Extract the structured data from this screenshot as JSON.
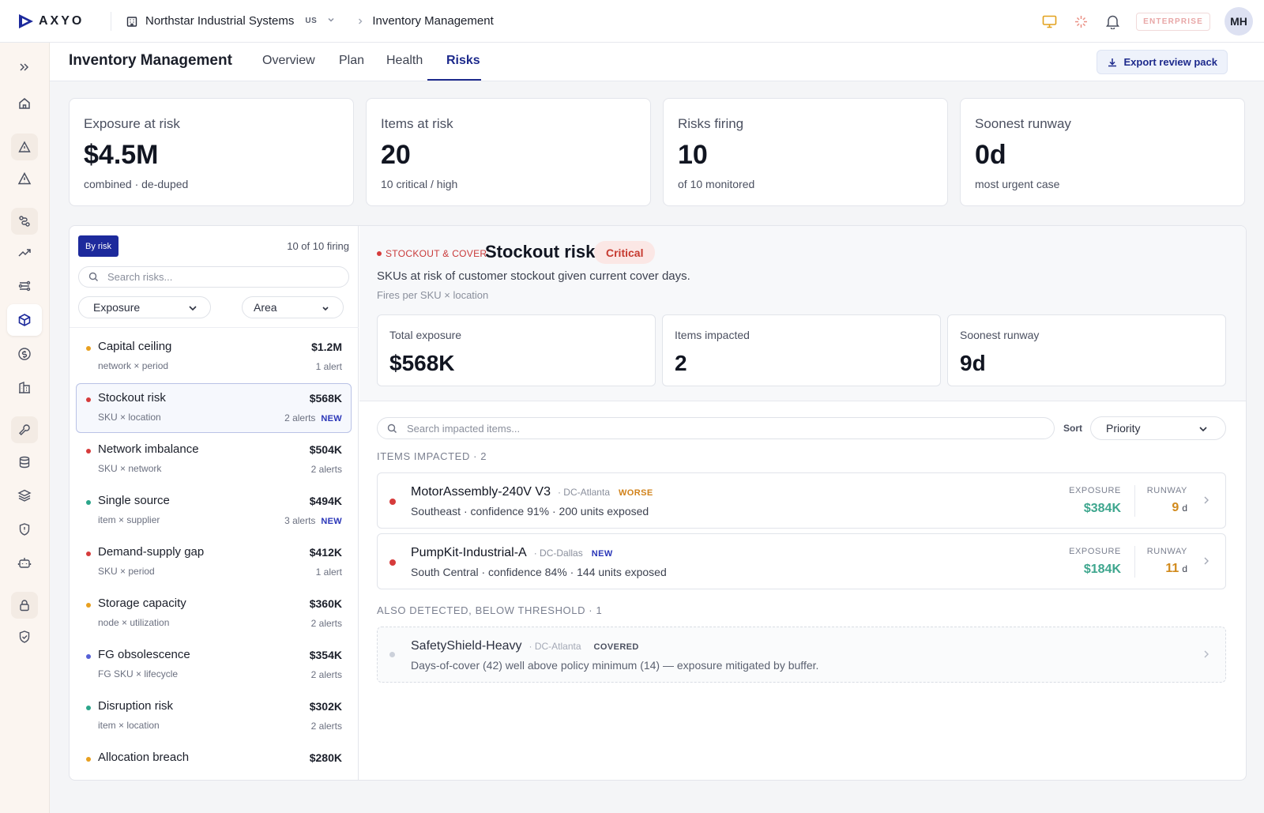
{
  "topbar": {
    "brand": "AXYO",
    "org_name": "Northstar Industrial Systems",
    "org_region": "US",
    "breadcrumb": "Inventory Management",
    "plan_badge": "ENTERPRISE",
    "avatar_initials": "MH"
  },
  "rail_icons": [
    "expand-icon",
    "home-icon",
    "alert-icon",
    "warning-icon",
    "route-icon",
    "trend-icon",
    "flow-icon",
    "inventory-icon",
    "finance-icon",
    "building-icon",
    "tools-icon",
    "database-icon",
    "layers-icon",
    "shield-icon",
    "robot-icon",
    "lock-icon",
    "shield-check-icon"
  ],
  "subheader": {
    "title": "Inventory Management",
    "tabs": [
      {
        "label": "Overview"
      },
      {
        "label": "Plan"
      },
      {
        "label": "Health"
      },
      {
        "label": "Risks"
      }
    ],
    "active_tab": "Risks",
    "export_label": "Export review pack"
  },
  "kpis": [
    {
      "label": "Exposure at risk",
      "value": "$4.5M",
      "sub": "combined · de-duped"
    },
    {
      "label": "Items at risk",
      "value": "20",
      "sub": "10 critical / high"
    },
    {
      "label": "Risks firing",
      "value": "10",
      "sub": "of 10 monitored"
    },
    {
      "label": "Soonest runway",
      "value": "0d",
      "sub": "most urgent case"
    }
  ],
  "risk_list": {
    "sort_chip": "By risk",
    "count_label": "10 of 10 firing",
    "search_placeholder": "Search risks...",
    "sort_select": "Exposure",
    "area_select": "Area",
    "items": [
      {
        "name": "Capital ceiling",
        "sub": "network × period",
        "amount": "$1.2M",
        "alerts": "1 alert",
        "new": "",
        "color": "#e8a020"
      },
      {
        "name": "Stockout risk",
        "sub": "SKU × location",
        "amount": "$568K",
        "alerts": "2 alerts",
        "new": "NEW",
        "color": "#d63b3b"
      },
      {
        "name": "Network imbalance",
        "sub": "SKU × network",
        "amount": "$504K",
        "alerts": "2 alerts",
        "new": "",
        "color": "#d63b3b"
      },
      {
        "name": "Single source",
        "sub": "item × supplier",
        "amount": "$494K",
        "alerts": "3 alerts",
        "new": "NEW",
        "color": "#2ba58a"
      },
      {
        "name": "Demand-supply gap",
        "sub": "SKU × period",
        "amount": "$412K",
        "alerts": "1 alert",
        "new": "",
        "color": "#d63b3b"
      },
      {
        "name": "Storage capacity",
        "sub": "node × utilization",
        "amount": "$360K",
        "alerts": "2 alerts",
        "new": "",
        "color": "#e8a020"
      },
      {
        "name": "FG obsolescence",
        "sub": "FG SKU × lifecycle",
        "amount": "$354K",
        "alerts": "2 alerts",
        "new": "",
        "color": "#5560d6"
      },
      {
        "name": "Disruption risk",
        "sub": "item × location",
        "amount": "$302K",
        "alerts": "2 alerts",
        "new": "",
        "color": "#2ba58a"
      },
      {
        "name": "Allocation breach",
        "sub": "",
        "amount": "$280K",
        "alerts": "",
        "new": "",
        "color": "#e8a020"
      }
    ]
  },
  "detail": {
    "category": "STOCKOUT & COVER",
    "title": "Stockout risk",
    "severity": "Critical",
    "description": "SKUs at risk of customer stockout given current cover days.",
    "fires_per": "Fires per SKU × location",
    "metrics": [
      {
        "label": "Total exposure",
        "value": "$568K"
      },
      {
        "label": "Items impacted",
        "value": "2"
      },
      {
        "label": "Soonest runway",
        "value": "9d"
      }
    ],
    "search_placeholder": "Search impacted items...",
    "sort_label": "Sort",
    "sort_value": "Priority",
    "impacted_label": "ITEMS IMPACTED · 2",
    "exposure_label": "EXPOSURE",
    "runway_label": "RUNWAY",
    "runway_unit": "d",
    "items": [
      {
        "name": "MotorAssembly-240V V3",
        "location": "· DC-Atlanta",
        "flag": "WORSE",
        "flag_color": "#d1821a",
        "sub": "Southeast · confidence 91% · 200 units exposed",
        "exposure": "$384K",
        "runway": "9",
        "dot": "#d63b3b"
      },
      {
        "name": "PumpKit-Industrial-A",
        "location": "· DC-Dallas",
        "flag": "NEW",
        "flag_color": "#2a36b8",
        "sub": "South Central · confidence 84% · 144 units exposed",
        "exposure": "$184K",
        "runway": "11",
        "dot": "#d63b3b"
      }
    ],
    "below_label": "ALSO DETECTED, BELOW THRESHOLD · 1",
    "below_item": {
      "name": "SafetyShield-Heavy",
      "location": "· DC-Atlanta",
      "flag": "COVERED",
      "sub": "Days-of-cover (42) well above policy minimum (14) — exposure mitigated by buffer."
    }
  }
}
